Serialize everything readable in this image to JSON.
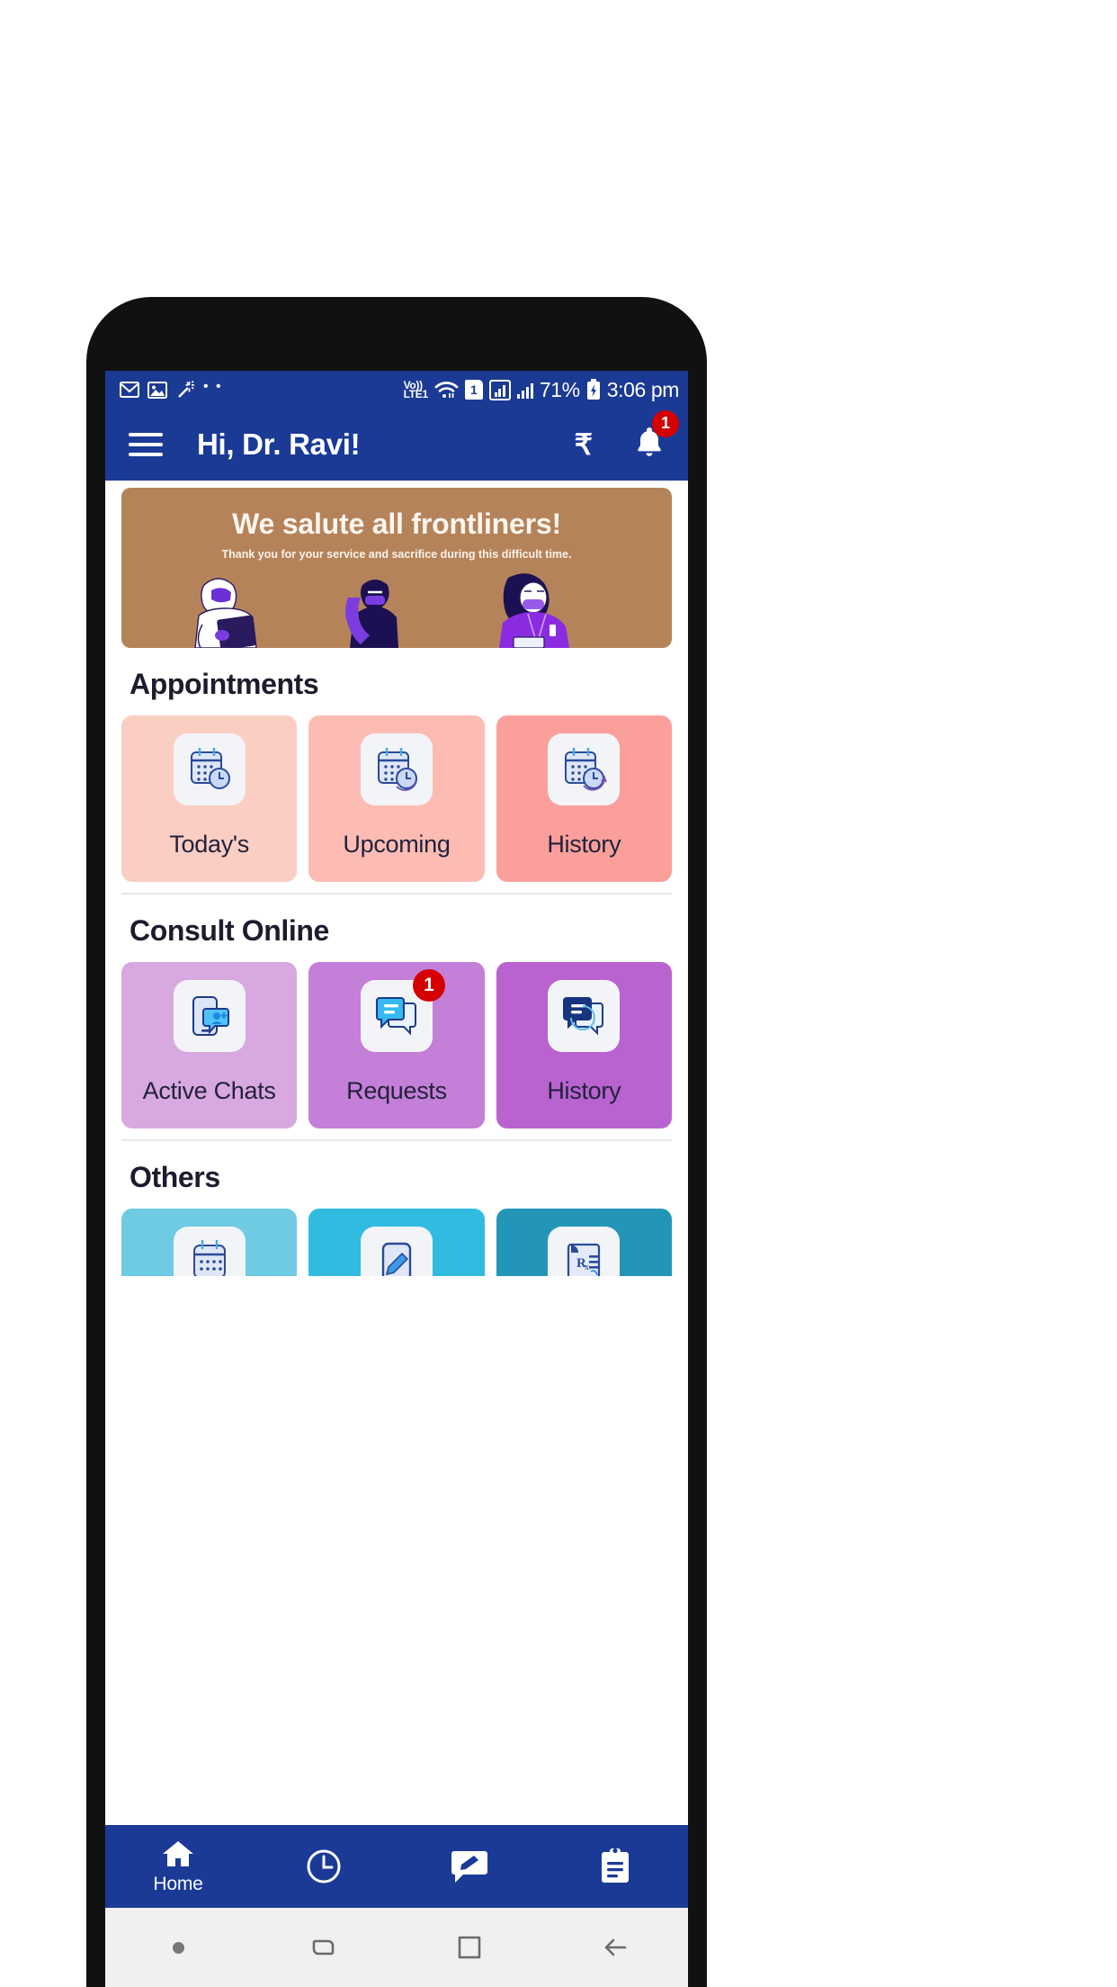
{
  "status_bar": {
    "left_icons": [
      "gmail-icon",
      "photos-icon",
      "magic-wand-icon",
      "more-dots-icon"
    ],
    "volte_top": "Vo))",
    "volte_bottom": "LTE1",
    "wifi_icon": "wifi-icon",
    "sim_label": "1",
    "battery_percent": "71%",
    "battery_icon": "battery-charging-icon",
    "time": "3:06 pm"
  },
  "header": {
    "menu_icon": "hamburger-menu-icon",
    "title": "Hi, Dr. Ravi!",
    "rupee_symbol": "₹",
    "bell_icon": "bell-icon",
    "notification_count": "1"
  },
  "banner": {
    "title": "We salute all frontliners!",
    "subtitle": "Thank you for your service and sacrifice during this difficult time.",
    "background_color": "#b5835a"
  },
  "sections": [
    {
      "title": "Appointments",
      "cards": [
        {
          "label": "Today's",
          "color": "#fbcec3",
          "icon": "calendar-clock-icon",
          "badge": null
        },
        {
          "label": "Upcoming",
          "color": "#fcbcb4",
          "icon": "calendar-clock-icon",
          "badge": null
        },
        {
          "label": "History",
          "color": "#fb9f9b",
          "icon": "calendar-clock-icon",
          "badge": null
        }
      ]
    },
    {
      "title": "Consult Online",
      "cards": [
        {
          "label": "Active Chats",
          "color": "#d8a8e0",
          "icon": "mobile-add-user-icon",
          "badge": null
        },
        {
          "label": "Requests",
          "color": "#c47fd8",
          "icon": "chat-bubbles-icon",
          "badge": "1"
        },
        {
          "label": "History",
          "color": "#b863cf",
          "icon": "chat-history-icon",
          "badge": null
        }
      ]
    },
    {
      "title": "Others",
      "cards": [
        {
          "label": "",
          "color": "#6ecbe2",
          "icon": "calendar-icon",
          "badge": null
        },
        {
          "label": "",
          "color": "#31bbe0",
          "icon": "note-edit-icon",
          "badge": null
        },
        {
          "label": "",
          "color": "#2396b8",
          "icon": "prescription-icon",
          "badge": null
        }
      ]
    }
  ],
  "bottom_nav": [
    {
      "label": "Home",
      "icon": "home-icon",
      "active": true
    },
    {
      "label": "",
      "icon": "clock-icon",
      "active": false
    },
    {
      "label": "",
      "icon": "chat-edit-icon",
      "active": false
    },
    {
      "label": "",
      "icon": "clipboard-icon",
      "active": false
    }
  ],
  "system_nav": [
    {
      "icon": "dot-icon"
    },
    {
      "icon": "swap-icon"
    },
    {
      "icon": "overview-square-icon"
    },
    {
      "icon": "back-arrow-icon"
    }
  ]
}
